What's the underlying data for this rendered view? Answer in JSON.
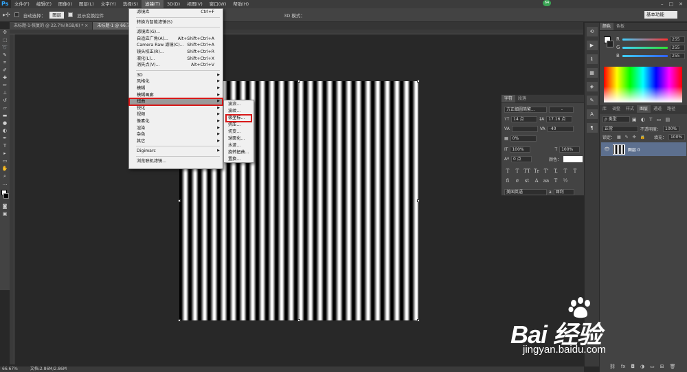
{
  "app": {
    "logo": "Ps",
    "user_badge": "64"
  },
  "menubar": {
    "items": [
      "文件(F)",
      "编辑(E)",
      "图像(I)",
      "图层(L)",
      "文字(Y)",
      "选择(S)",
      "滤镜(T)",
      "3D(D)",
      "视图(V)",
      "窗口(W)",
      "帮助(H)"
    ],
    "active_index": 6,
    "window_controls": [
      "–",
      "□",
      "✕"
    ]
  },
  "options_bar": {
    "auto_select_label": "自动选择：",
    "auto_select_value": "图层",
    "show_transform_label": "显示变换控件",
    "mode_3d_label": "3D 模式：",
    "workspace": "基本功能"
  },
  "tabs": [
    {
      "label": "未标题-1-恢复的 @ 22.7%(RGB/8) *",
      "active": false
    },
    {
      "label": "未标题-1 @ 66.7%",
      "active": true
    }
  ],
  "filter_menu": {
    "items": [
      {
        "label": "滤镜库",
        "shortcut": "Ctrl+F"
      },
      {
        "sep": true
      },
      {
        "label": "转换为智能滤镜(S)"
      },
      {
        "sep": true
      },
      {
        "label": "滤镜库(G)..."
      },
      {
        "label": "自适应广角(A)...",
        "shortcut": "Alt+Shift+Ctrl+A"
      },
      {
        "label": "Camera Raw 滤镜(C)...",
        "shortcut": "Shift+Ctrl+A"
      },
      {
        "label": "镜头校正(R)...",
        "shortcut": "Shift+Ctrl+R"
      },
      {
        "label": "液化(L)...",
        "shortcut": "Shift+Ctrl+X"
      },
      {
        "label": "消失点(V)...",
        "shortcut": "Alt+Ctrl+V"
      },
      {
        "sep": true
      },
      {
        "label": "3D",
        "sub": true
      },
      {
        "label": "风格化",
        "sub": true
      },
      {
        "label": "模糊",
        "sub": true
      },
      {
        "label": "模糊画廊",
        "sub": true
      },
      {
        "label": "扭曲",
        "sub": true,
        "highlight": true
      },
      {
        "label": "锐化",
        "sub": true
      },
      {
        "label": "视频",
        "sub": true
      },
      {
        "label": "像素化",
        "sub": true
      },
      {
        "label": "渲染",
        "sub": true
      },
      {
        "label": "杂色",
        "sub": true
      },
      {
        "label": "其它",
        "sub": true
      },
      {
        "sep": true
      },
      {
        "label": "Digimarc",
        "sub": true
      },
      {
        "sep": true
      },
      {
        "label": "浏览联机滤镜..."
      }
    ]
  },
  "distort_submenu": {
    "items": [
      {
        "label": "波浪..."
      },
      {
        "label": "波纹..."
      },
      {
        "label": "极坐标...",
        "highlight": true
      },
      {
        "label": "挤压..."
      },
      {
        "label": "切变..."
      },
      {
        "label": "球面化..."
      },
      {
        "label": "水波..."
      },
      {
        "label": "旋转扭曲..."
      },
      {
        "label": "置换..."
      }
    ]
  },
  "status_bar": {
    "zoom": "66.67%",
    "doc": "文档:2.86M/2.86M"
  },
  "color_panel": {
    "tabs": [
      "颜色",
      "色板"
    ],
    "channels": [
      {
        "label": "R",
        "value": "255",
        "color": "#ff3030"
      },
      {
        "label": "G",
        "value": "255",
        "color": "#30e030"
      },
      {
        "label": "B",
        "value": "255",
        "color": "#3060ff"
      }
    ]
  },
  "adjust_tabs": [
    "库",
    "调整",
    "样式",
    "图层",
    "通道",
    "路径"
  ],
  "layers_panel": {
    "kind_label": "ρ 类型",
    "blend_mode": "正常",
    "opacity_label": "不透明度：",
    "opacity_value": "100%",
    "lock_label": "锁定：",
    "fill_label": "填充：",
    "fill_value": "100%",
    "layer_name": "图层 0"
  },
  "char_panel": {
    "tabs": [
      "字符",
      "段落"
    ],
    "font_family": "方正细圆简繁...",
    "font_style": "-",
    "font_size": "14 点",
    "leading": "17.16 点",
    "kerning_label": "VA",
    "tracking": "-40",
    "scale_pct": "0%",
    "vert_scale": "100%",
    "horiz_scale": "100%",
    "baseline": "0 点",
    "color_label": "颜色：",
    "style_buttons": [
      "T",
      "T",
      "TT",
      "Tr",
      "T'",
      "T,",
      "T",
      "T"
    ],
    "language": "美国英语",
    "aa_label": "a",
    "aa_value": "犀利"
  },
  "watermark": {
    "brand": "Bai 经验",
    "url": "jingyan.baidu.com"
  },
  "icons": {
    "minibar": [
      "history-icon",
      "actions-icon",
      "info-icon",
      "swatches-icon",
      "type-icon",
      "paragraph-icon"
    ]
  }
}
